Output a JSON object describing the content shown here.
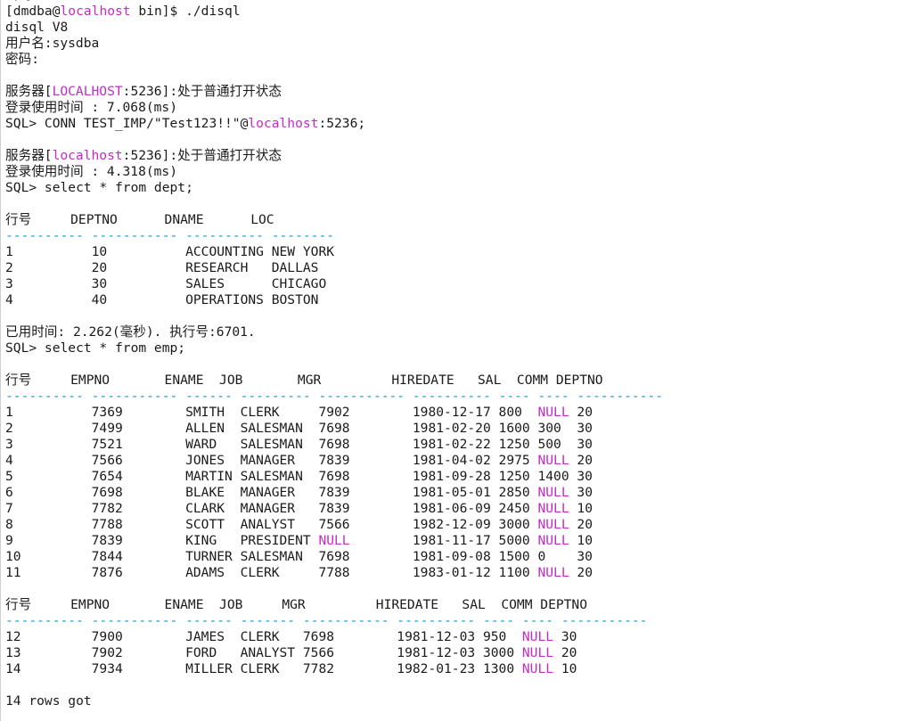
{
  "terminal": {
    "title": "disql session",
    "accent_color": "#c42bc4",
    "separator_color": "#1e90c8",
    "lines": [
      [
        {
          "t": "密码:"
        }
      ],
      [
        {
          "t": "[dmdba@"
        },
        {
          "t": "localhost",
          "c": "hl"
        },
        {
          "t": " bin]$ ./disql"
        }
      ],
      [
        {
          "t": "disql V8"
        }
      ],
      [
        {
          "t": "用户名:sysdba"
        }
      ],
      [
        {
          "t": "密码:"
        }
      ],
      [
        {
          "t": ""
        }
      ],
      [
        {
          "t": "服务器["
        },
        {
          "t": "LOCALHOST",
          "c": "hl"
        },
        {
          "t": ":5236]:处于普通打开状态"
        }
      ],
      [
        {
          "t": "登录使用时间 : 7.068(ms)"
        }
      ],
      [
        {
          "t": "SQL> CONN TEST_IMP/\"Test123!!\"@"
        },
        {
          "t": "localhost",
          "c": "hl"
        },
        {
          "t": ":5236;"
        }
      ],
      [
        {
          "t": ""
        }
      ],
      [
        {
          "t": "服务器["
        },
        {
          "t": "localhost",
          "c": "hl"
        },
        {
          "t": ":5236]:处于普通打开状态"
        }
      ],
      [
        {
          "t": "登录使用时间 : 4.318(ms)"
        }
      ],
      [
        {
          "t": "SQL> select * from dept;"
        }
      ],
      [
        {
          "t": ""
        }
      ],
      [
        {
          "t": "行号     DEPTNO      DNAME      LOC"
        }
      ],
      [
        {
          "t": "---------- ----------- ---------- --------",
          "c": "sep"
        }
      ],
      [
        {
          "t": "1          10          ACCOUNTING NEW YORK"
        }
      ],
      [
        {
          "t": "2          20          RESEARCH   DALLAS"
        }
      ],
      [
        {
          "t": "3          30          SALES      CHICAGO"
        }
      ],
      [
        {
          "t": "4          40          OPERATIONS BOSTON"
        }
      ],
      [
        {
          "t": ""
        }
      ],
      [
        {
          "t": "已用时间: 2.262(毫秒). 执行号:6701."
        }
      ],
      [
        {
          "t": "SQL> select * from emp;"
        }
      ],
      [
        {
          "t": ""
        }
      ],
      [
        {
          "t": "行号     EMPNO       ENAME  JOB       MGR         HIREDATE   SAL  COMM DEPTNO"
        }
      ],
      [
        {
          "t": "---------- ----------- ------ --------- ----------- ---------- ---- ---- -----------",
          "c": "sep"
        }
      ],
      [
        {
          "t": "1          7369        SMITH  CLERK     7902        1980-12-17 800  "
        },
        {
          "t": "NULL",
          "c": "hl"
        },
        {
          "t": " 20"
        }
      ],
      [
        {
          "t": "2          7499        ALLEN  SALESMAN  7698        1981-02-20 1600 300  30"
        }
      ],
      [
        {
          "t": "3          7521        WARD   SALESMAN  7698        1981-02-22 1250 500  30"
        }
      ],
      [
        {
          "t": "4          7566        JONES  MANAGER   7839        1981-04-02 2975 "
        },
        {
          "t": "NULL",
          "c": "hl"
        },
        {
          "t": " 20"
        }
      ],
      [
        {
          "t": "5          7654        MARTIN SALESMAN  7698        1981-09-28 1250 1400 30"
        }
      ],
      [
        {
          "t": "6          7698        BLAKE  MANAGER   7839        1981-05-01 2850 "
        },
        {
          "t": "NULL",
          "c": "hl"
        },
        {
          "t": " 30"
        }
      ],
      [
        {
          "t": "7          7782        CLARK  MANAGER   7839        1981-06-09 2450 "
        },
        {
          "t": "NULL",
          "c": "hl"
        },
        {
          "t": " 10"
        }
      ],
      [
        {
          "t": "8          7788        SCOTT  ANALYST   7566        1982-12-09 3000 "
        },
        {
          "t": "NULL",
          "c": "hl"
        },
        {
          "t": " 20"
        }
      ],
      [
        {
          "t": "9          7839        KING   PRESIDENT "
        },
        {
          "t": "NULL",
          "c": "hl"
        },
        {
          "t": "        1981-11-17 5000 "
        },
        {
          "t": "NULL",
          "c": "hl"
        },
        {
          "t": " 10"
        }
      ],
      [
        {
          "t": "10         7844        TURNER SALESMAN  7698        1981-09-08 1500 0    30"
        }
      ],
      [
        {
          "t": "11         7876        ADAMS  CLERK     7788        1983-01-12 1100 "
        },
        {
          "t": "NULL",
          "c": "hl"
        },
        {
          "t": " 20"
        }
      ],
      [
        {
          "t": ""
        }
      ],
      [
        {
          "t": "行号     EMPNO       ENAME  JOB     MGR         HIREDATE   SAL  COMM DEPTNO"
        }
      ],
      [
        {
          "t": "---------- ----------- ------ ------- ----------- ---------- ---- ---- -----------",
          "c": "sep"
        }
      ],
      [
        {
          "t": "12         7900        JAMES  CLERK   7698        1981-12-03 950  "
        },
        {
          "t": "NULL",
          "c": "hl"
        },
        {
          "t": " 30"
        }
      ],
      [
        {
          "t": "13         7902        FORD   ANALYST 7566        1981-12-03 3000 "
        },
        {
          "t": "NULL",
          "c": "hl"
        },
        {
          "t": " 20"
        }
      ],
      [
        {
          "t": "14         7934        MILLER CLERK   7782        1982-01-23 1300 "
        },
        {
          "t": "NULL",
          "c": "hl"
        },
        {
          "t": " 10"
        }
      ],
      [
        {
          "t": ""
        }
      ],
      [
        {
          "t": "14 rows got"
        }
      ]
    ]
  }
}
